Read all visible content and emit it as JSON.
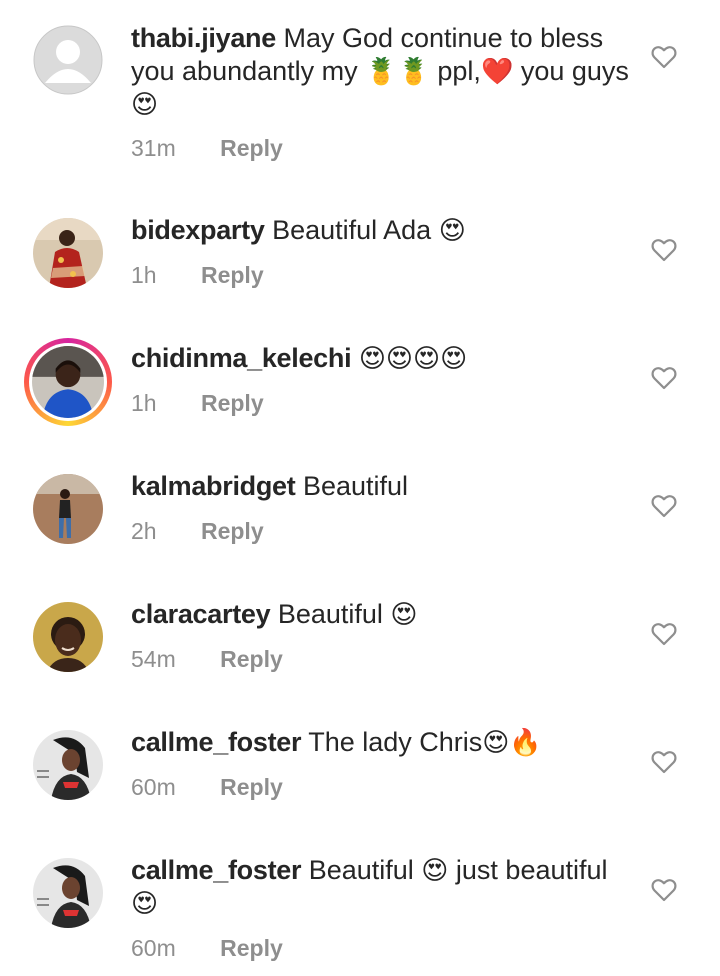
{
  "comments": [
    {
      "username": "thabi.jiyane",
      "text_parts": [
        "May God continue to bless you abundantly my ",
        "🍍🍍",
        " ppl,",
        "❤️",
        " you guys",
        "😍"
      ],
      "time": "31m",
      "reply": "Reply",
      "avatar_icon": "default-profile-icon"
    },
    {
      "username": "bidexparty",
      "text_parts": [
        "Beautiful Ada ",
        "😍"
      ],
      "time": "1h",
      "reply": "Reply",
      "avatar_icon": "profile-photo"
    },
    {
      "username": "chidinma_kelechi",
      "text_parts": [
        "",
        "😍😍😍😍"
      ],
      "time": "1h",
      "reply": "Reply",
      "avatar_icon": "profile-photo-story-ring"
    },
    {
      "username": "kalmabridget",
      "text_parts": [
        "Beautiful"
      ],
      "time": "2h",
      "reply": "Reply",
      "avatar_icon": "profile-photo"
    },
    {
      "username": "claracartey",
      "text_parts": [
        "Beautiful ",
        "😍"
      ],
      "time": "54m",
      "reply": "Reply",
      "avatar_icon": "profile-photo"
    },
    {
      "username": "callme_foster",
      "text_parts": [
        "The lady Chris",
        "😍🔥"
      ],
      "time": "60m",
      "reply": "Reply",
      "avatar_icon": "profile-photo"
    },
    {
      "username": "callme_foster",
      "text_parts": [
        "Beautiful ",
        "😍",
        " just beautiful",
        "😍"
      ],
      "time": "60m",
      "reply": "Reply",
      "avatar_icon": "profile-photo"
    }
  ],
  "colors": {
    "text": "#262626",
    "meta": "#8e8e8e",
    "heart_outline": "#8e8e8e"
  }
}
